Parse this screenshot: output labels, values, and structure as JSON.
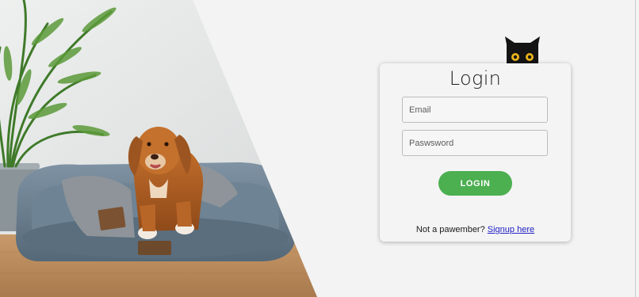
{
  "login": {
    "title": "Login",
    "email_placeholder": "Email",
    "password_placeholder": "Paswsword",
    "button_label": "LOGIN",
    "footer_text": "Not a pawember?",
    "signup_link": "Signup here"
  },
  "colors": {
    "page_background": "#f3f3f3",
    "button": "#4caf50",
    "link": "#2121c4"
  },
  "icons": {
    "mascot": "black-cat-peeking-icon"
  }
}
